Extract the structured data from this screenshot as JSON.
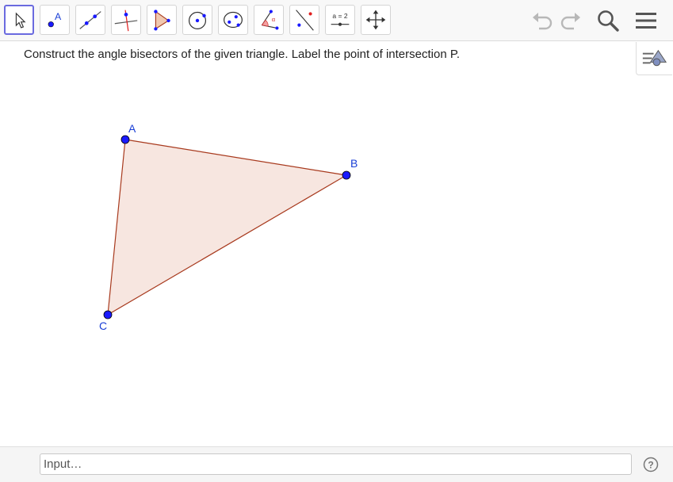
{
  "toolbar": {
    "tools": [
      {
        "id": "move",
        "name": "move-tool"
      },
      {
        "id": "point",
        "name": "point-tool",
        "label": "A"
      },
      {
        "id": "line",
        "name": "line-tool"
      },
      {
        "id": "perpendicular",
        "name": "perpendicular-line-tool"
      },
      {
        "id": "polygon",
        "name": "polygon-tool"
      },
      {
        "id": "circle",
        "name": "circle-tool"
      },
      {
        "id": "ellipse",
        "name": "ellipse-tool"
      },
      {
        "id": "angle",
        "name": "angle-tool",
        "label": "α"
      },
      {
        "id": "reflect",
        "name": "reflect-tool"
      },
      {
        "id": "slider",
        "name": "slider-tool",
        "label": "a = 2"
      },
      {
        "id": "move-graphics",
        "name": "move-graphics-view-tool"
      }
    ],
    "active_tool": "move"
  },
  "instruction": "Construct the angle bisectors of the given triangle.  Label the point of intersection P.",
  "construction": {
    "points": [
      {
        "label": "A"
      },
      {
        "label": "B"
      },
      {
        "label": "C"
      }
    ],
    "triangle_fill": "#f7e6e0",
    "triangle_stroke": "#a83a1e",
    "point_color": "#1a1aff"
  },
  "input": {
    "placeholder": "Input…",
    "value": ""
  },
  "help_label": "?"
}
